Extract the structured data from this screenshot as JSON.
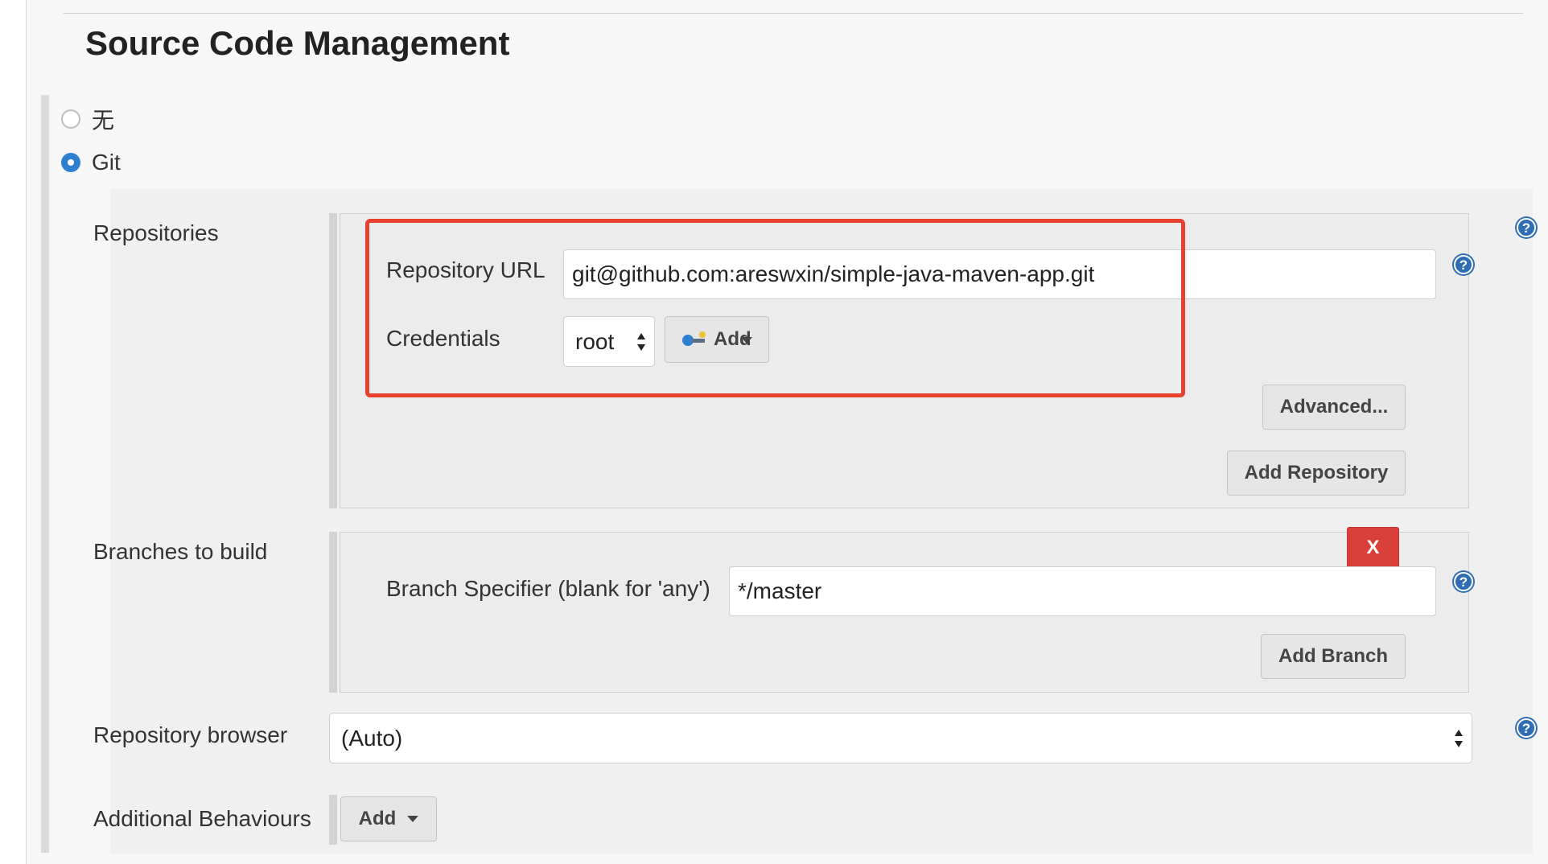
{
  "section": {
    "title": "Source Code Management"
  },
  "scm_options": [
    {
      "label": "无",
      "selected": false
    },
    {
      "label": "Git",
      "selected": true
    }
  ],
  "repositories": {
    "label": "Repositories",
    "url_label": "Repository URL",
    "url_value": "git@github.com:areswxin/simple-java-maven-app.git",
    "credentials_label": "Credentials",
    "credentials_value": "root",
    "add_credentials_label": "Add",
    "advanced_label": "Advanced...",
    "add_repository_label": "Add Repository"
  },
  "branches": {
    "label": "Branches to build",
    "remove_label": "X",
    "specifier_label": "Branch Specifier (blank for 'any')",
    "specifier_value": "*/master",
    "add_branch_label": "Add Branch"
  },
  "repository_browser": {
    "label": "Repository browser",
    "value": "(Auto)"
  },
  "additional_behaviours": {
    "label": "Additional Behaviours",
    "add_label": "Add"
  },
  "colors": {
    "highlight": "#e8422f",
    "radio_selected": "#2f7fd1",
    "delete_button": "#d9403a",
    "help_icon": "#2f6db5"
  },
  "icons": {
    "help": "help-icon",
    "key": "key-icon",
    "dropdown": "caret-down-icon"
  }
}
